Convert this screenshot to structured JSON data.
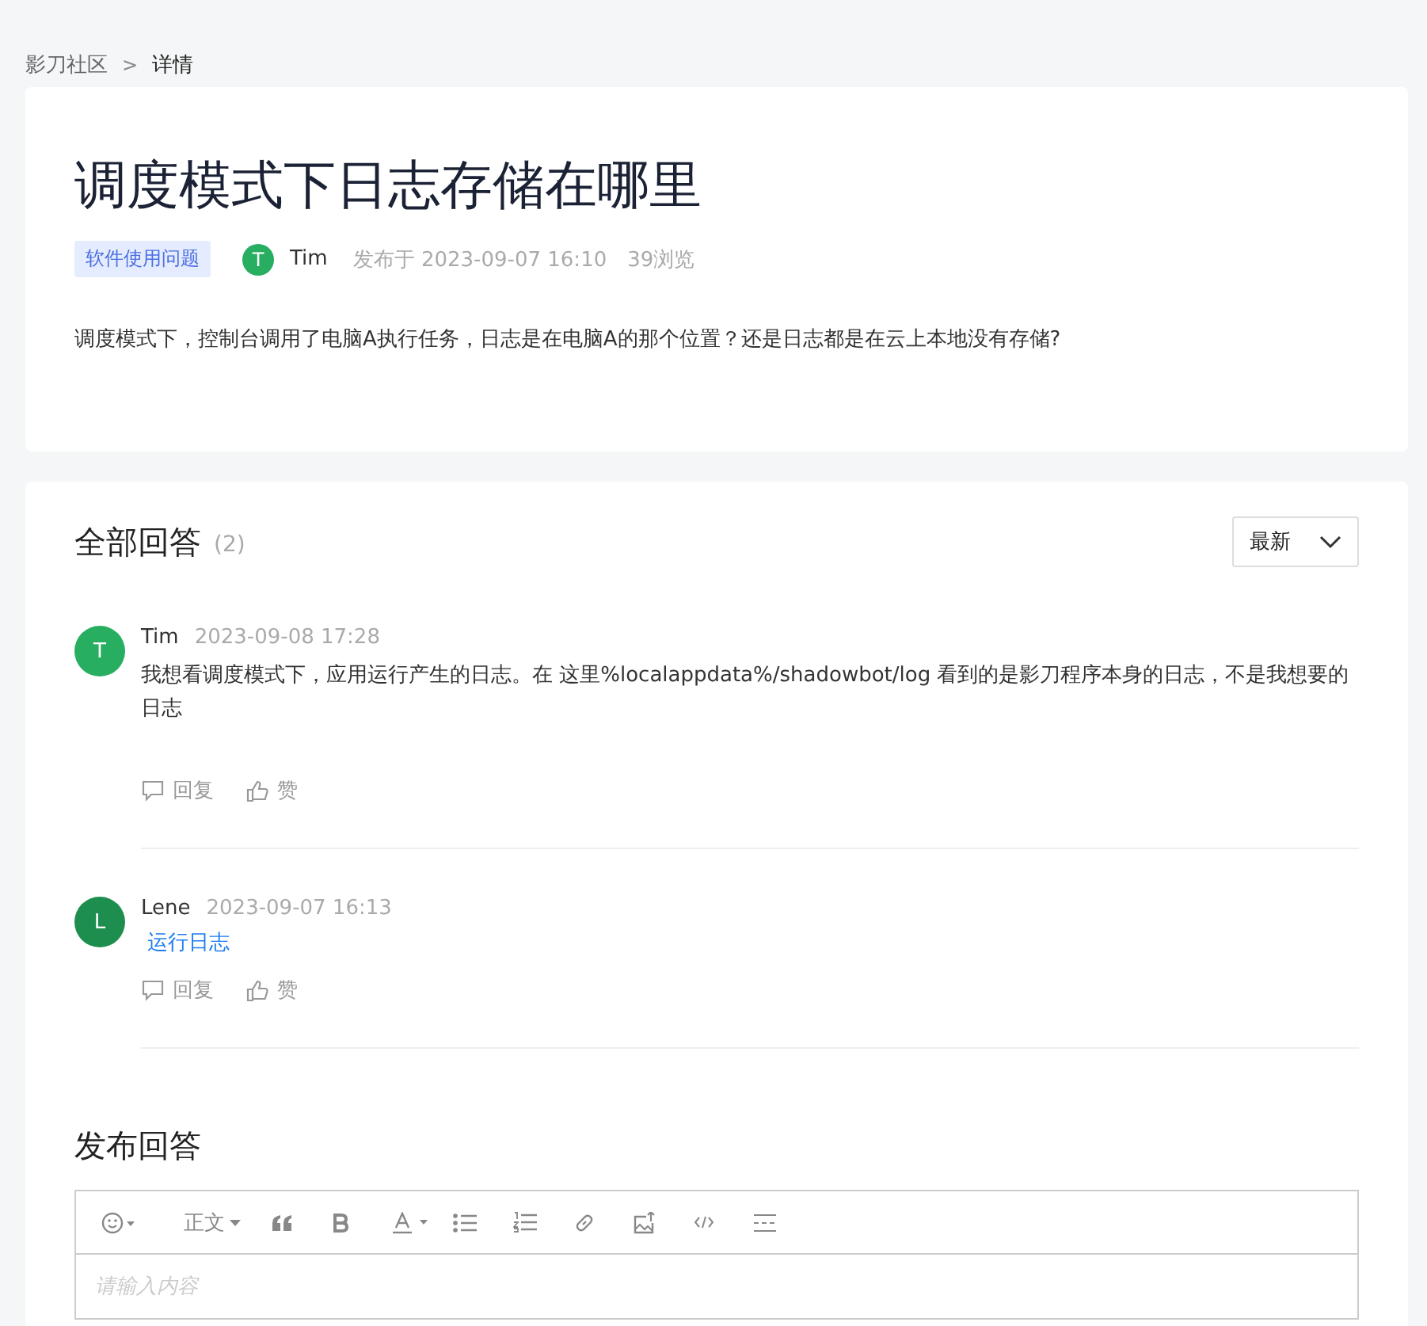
{
  "breadcrumb": [
    {
      "label": "影刀社区"
    },
    {
      "label": "详情"
    }
  ],
  "breadcrumb_separator": ">",
  "question": {
    "title": "调度模式下日志存储在哪里",
    "tag": "软件使用问题",
    "author": {
      "initial": "T",
      "name": "Tim",
      "color": "#27ae60"
    },
    "published": "发布于 2023-09-07 16:10",
    "views": "39浏览",
    "body": "调度模式下，控制台调用了电脑A执行任务，日志是在电脑A的那个位置？还是日志都是在云上本地没有存储?"
  },
  "answers": {
    "title": "全部回答",
    "count": "(2)",
    "sort": "最新",
    "items": [
      {
        "initial": "T",
        "color": "#27ae60",
        "name": "Tim",
        "time": "2023-09-08 17:28",
        "kind": "text",
        "body": "我想看调度模式下，应用运行产生的日志。在 这里%localappdata%/shadowbot/log 看到的是影刀程序本身的日志，不是我想要的日志",
        "reply": "回复",
        "like": "赞"
      },
      {
        "initial": "L",
        "color": "#1e8e4e",
        "name": "Lene",
        "time": "2023-09-07 16:13",
        "kind": "link",
        "body": "运行日志",
        "reply": "回复",
        "like": "赞"
      }
    ]
  },
  "compose": {
    "title": "发布回答",
    "toolbar": {
      "style": "正文"
    },
    "placeholder": "请输入内容"
  }
}
